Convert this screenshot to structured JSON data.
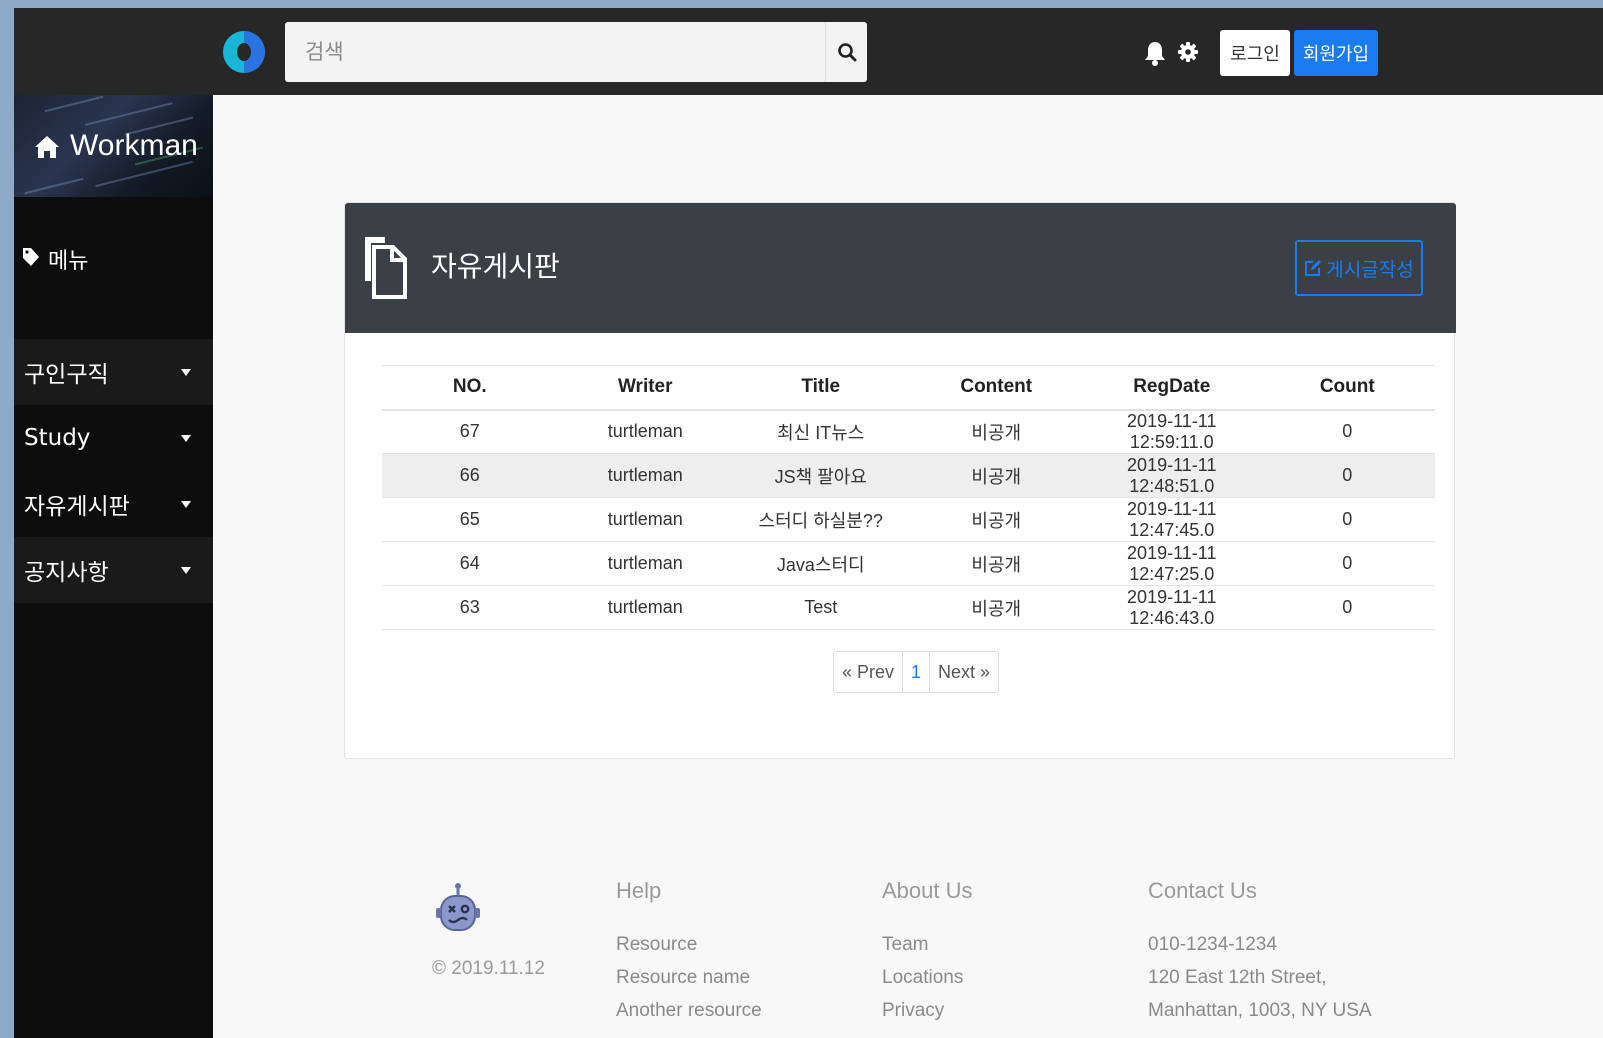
{
  "header": {
    "search_placeholder": "검색",
    "login_label": "로그인",
    "signup_label": "회원가입",
    "accent_color": "#1a7cf0"
  },
  "sidebar": {
    "brand": "Workman",
    "menu_label": "메뉴",
    "items": [
      {
        "label": "구인구직"
      },
      {
        "label": "Study"
      },
      {
        "label": "자유게시판"
      },
      {
        "label": "공지사항"
      }
    ]
  },
  "board": {
    "title": "자유게시판",
    "write_label": "게시글작성",
    "columns": [
      "NO.",
      "Writer",
      "Title",
      "Content",
      "RegDate",
      "Count"
    ],
    "rows": [
      {
        "no": "67",
        "writer": "turtleman",
        "title": "최신 IT뉴스",
        "content": "비공개",
        "regdate": "2019-11-11 12:59:11.0",
        "count": "0"
      },
      {
        "no": "66",
        "writer": "turtleman",
        "title": "JS책 팔아요",
        "content": "비공개",
        "regdate": "2019-11-11 12:48:51.0",
        "count": "0"
      },
      {
        "no": "65",
        "writer": "turtleman",
        "title": "스터디 하실분??",
        "content": "비공개",
        "regdate": "2019-11-11 12:47:45.0",
        "count": "0"
      },
      {
        "no": "64",
        "writer": "turtleman",
        "title": "Java스터디",
        "content": "비공개",
        "regdate": "2019-11-11 12:47:25.0",
        "count": "0"
      },
      {
        "no": "63",
        "writer": "turtleman",
        "title": "Test",
        "content": "비공개",
        "regdate": "2019-11-11 12:46:43.0",
        "count": "0"
      }
    ],
    "pagination": {
      "prev": "« Prev",
      "current": "1",
      "next": "Next »"
    }
  },
  "footer": {
    "copyright": "© 2019.11.12",
    "help": {
      "heading": "Help",
      "links": [
        "Resource",
        "Resource name",
        "Another resource"
      ]
    },
    "about": {
      "heading": "About Us",
      "links": [
        "Team",
        "Locations",
        "Privacy"
      ]
    },
    "contact": {
      "heading": "Contact Us",
      "lines": [
        "010-1234-1234",
        "120 East 12th Street,",
        "Manhattan, 1003, NY USA"
      ]
    }
  }
}
